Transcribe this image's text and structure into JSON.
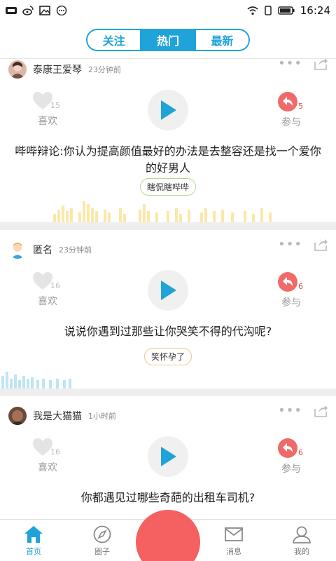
{
  "status_bar": {
    "time": "16:24"
  },
  "tabs": [
    {
      "label": "关注",
      "active": false
    },
    {
      "label": "热门",
      "active": true
    },
    {
      "label": "最新",
      "active": false
    }
  ],
  "posts": [
    {
      "user": "泰康王爱琴",
      "time": "23分钟前",
      "likes": "15",
      "like_label": "喜欢",
      "replies": "5",
      "reply_label": "参与",
      "title": "哔哔辩论:你认为提高颜值最好的办法是去整容还是找一个爱你的好男人",
      "tag": "瞎侃瞎哔哔"
    },
    {
      "user": "匿名",
      "time": "23分钟前",
      "likes": "16",
      "like_label": "喜欢",
      "replies": "6",
      "reply_label": "参与",
      "title": "说说你遇到过那些让你哭笑不得的代沟呢?",
      "tag": "笑怀孕了"
    },
    {
      "user": "我是大猫猫",
      "time": "1小时前",
      "likes": "16",
      "like_label": "喜欢",
      "replies": "6",
      "reply_label": "参与",
      "title": "你都遇见过哪些奇葩的出租车司机?",
      "tag": ""
    }
  ],
  "more_glyph": "•••",
  "bottom_nav": [
    {
      "label": "首页",
      "icon": "home-icon",
      "active": true
    },
    {
      "label": "圈子",
      "icon": "compass-icon",
      "active": false
    },
    {
      "label": "消息",
      "icon": "mail-icon",
      "active": false
    },
    {
      "label": "我的",
      "icon": "user-icon",
      "active": false
    }
  ],
  "colors": {
    "accent": "#1fa3d8",
    "play": "#1fa3d8",
    "reply": "#f06a6a",
    "fab": "#f56060",
    "wave_yellow": "#fbe7a8",
    "wave_blue": "#bfe4f5"
  }
}
